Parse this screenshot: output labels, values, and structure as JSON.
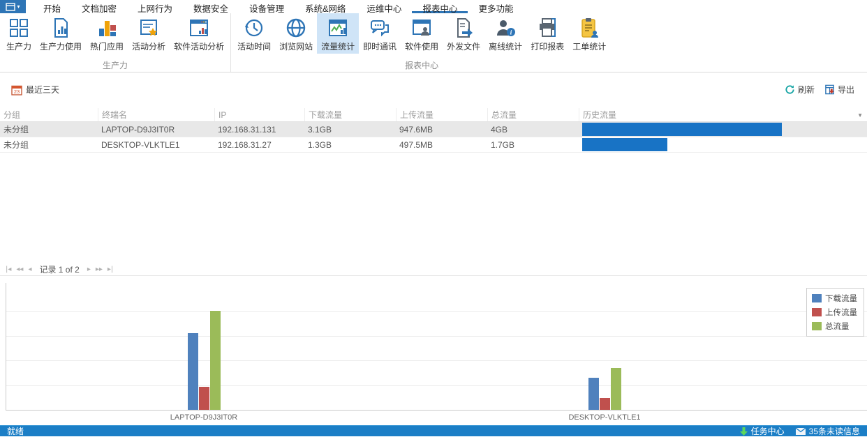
{
  "tabbar": {
    "tabs": [
      {
        "label": "开始"
      },
      {
        "label": "文档加密"
      },
      {
        "label": "上网行为"
      },
      {
        "label": "数据安全"
      },
      {
        "label": "设备管理"
      },
      {
        "label": "系统&网络"
      },
      {
        "label": "运维中心"
      },
      {
        "label": "报表中心"
      },
      {
        "label": "更多功能"
      }
    ],
    "selected_label": "报表中心"
  },
  "ribbon": {
    "groups": [
      {
        "label": "生产力",
        "items": [
          {
            "label": "生产力",
            "icon": "grid-icon"
          },
          {
            "label": "生产力使用",
            "icon": "doc-bar-chart-icon"
          },
          {
            "label": "热门应用",
            "icon": "bar-chart-icon"
          },
          {
            "label": "活动分析",
            "icon": "doc-star-icon"
          },
          {
            "label": "软件活动分析",
            "icon": "window-bar-chart-icon"
          }
        ]
      },
      {
        "label": "报表中心",
        "items": [
          {
            "label": "活动时间",
            "icon": "clock-history-icon"
          },
          {
            "label": "浏览网站",
            "icon": "globe-icon"
          },
          {
            "label": "流量统计",
            "icon": "traffic-line-chart-icon",
            "selected": true
          },
          {
            "label": "即时通讯",
            "icon": "chat-bubbles-icon"
          },
          {
            "label": "软件使用",
            "icon": "window-user-icon"
          },
          {
            "label": "外发文件",
            "icon": "file-export-icon"
          },
          {
            "label": "离线统计",
            "icon": "user-info-icon"
          },
          {
            "label": "打印报表",
            "icon": "printer-icon"
          },
          {
            "label": "工单统计",
            "icon": "clipboard-user-icon"
          }
        ]
      }
    ]
  },
  "filterbar": {
    "date_range_label": "最近三天",
    "refresh_label": "刷新",
    "export_label": "导出"
  },
  "table": {
    "columns": [
      "分组",
      "终端名",
      "IP",
      "下载流量",
      "上传流量",
      "总流量",
      "历史流量"
    ],
    "selected_row_index": 0,
    "rows": [
      {
        "group": "未分组",
        "terminal": "LAPTOP-D9J3IT0R",
        "ip": "192.168.31.131",
        "download": "3.1GB",
        "upload": "947.6MB",
        "total": "4GB",
        "total_gb": 4.0
      },
      {
        "group": "未分组",
        "terminal": "DESKTOP-VLKTLE1",
        "ip": "192.168.31.27",
        "download": "1.3GB",
        "upload": "497.5MB",
        "total": "1.7GB",
        "total_gb": 1.7
      }
    ]
  },
  "pager": {
    "record_text": "记录 1 of 2"
  },
  "chart_data": {
    "type": "bar",
    "title": "",
    "xlabel": "",
    "ylabel": "",
    "unit": "GB",
    "categories": [
      "LAPTOP-D9J3IT0R",
      "DESKTOP-VLKTLE1"
    ],
    "series": [
      {
        "name": "下载流量",
        "color": "#4f81bd",
        "values": [
          3.1,
          1.3
        ]
      },
      {
        "name": "上传流量",
        "color": "#c0504d",
        "values": [
          0.93,
          0.49
        ]
      },
      {
        "name": "总流量",
        "color": "#9bbb59",
        "values": [
          4.0,
          1.7
        ]
      }
    ],
    "ylim": [
      0,
      5
    ],
    "grid": true,
    "gridline_step": 1,
    "y_tick_labels_visible": false,
    "legend_position": "top-right"
  },
  "statusbar": {
    "ready_label": "就绪",
    "task_center_label": "任务中心",
    "unread_label": "35条未读信息"
  },
  "icons": {
    "app_caret": "▾",
    "column_filter": "▼",
    "pager_first": "|◂",
    "pager_fast_prev": "◂◂",
    "pager_prev": "◂",
    "pager_next": "▸",
    "pager_fast_next": "▸▸",
    "pager_last": "▸|"
  },
  "colors": {
    "accent": "#2e75b6",
    "ribbon_selected_bg": "#cfe4f7",
    "history_bar": "#1873c5",
    "statusbar_bg": "#1b7ec6",
    "refresh_icon": "#14a3a3",
    "task_arrow": "#5cd65c"
  }
}
